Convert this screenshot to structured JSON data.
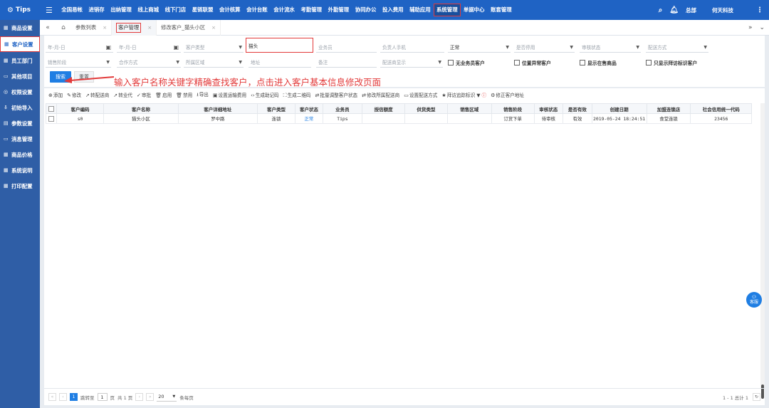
{
  "topbar": {
    "logo": "Tips",
    "menu": [
      "全国易帐",
      "进销存",
      "出纳管理",
      "线上商城",
      "线下门店",
      "星链联盟",
      "会计核算",
      "会计台账",
      "会计流水",
      "考勤管理",
      "外勤管理",
      "协同办公",
      "投入费用",
      "辅助应用",
      "系统管理",
      "单据中心",
      "账套管理"
    ],
    "active_menu": "系统管理",
    "user_role": "总部",
    "company": "何天科技"
  },
  "sidebar": {
    "items": [
      {
        "label": "商品设置"
      },
      {
        "label": "客户设置"
      },
      {
        "label": "员工部门"
      },
      {
        "label": "其他项目"
      },
      {
        "label": "权限设置"
      },
      {
        "label": "初始导入"
      },
      {
        "label": "参数设置"
      },
      {
        "label": "消息管理"
      },
      {
        "label": "商品价格"
      },
      {
        "label": "系统说明"
      },
      {
        "label": "打印配置"
      }
    ],
    "active_index": 1
  },
  "tabs": {
    "items": [
      {
        "label": "参数列表"
      },
      {
        "label": "客户管理"
      },
      {
        "label": "修改客户_猫头小区"
      }
    ],
    "active_index": 1
  },
  "filters": {
    "date_start_placeholder": "年-月-日",
    "date_end_placeholder": "年-月-日",
    "customer_type_placeholder": "客户类型",
    "keyword_value": "猫头",
    "salesman_placeholder": "业务员",
    "owner_phone_placeholder": "负责人手机",
    "status_value": "正常",
    "disabled_placeholder": "是否停用",
    "audit_placeholder": "审核状态",
    "delivery_placeholder": "配送方式",
    "sales_stage_placeholder": "销售阶段",
    "cooperation_placeholder": "合作方式",
    "region_placeholder": "所属区域",
    "address_placeholder": "地址",
    "remark_placeholder": "备注",
    "distributor_placeholder": "配送商显示",
    "cb_no_salesman": "无业务员客户",
    "cb_abnormal_position": "位置异常客户",
    "cb_show_on_sale": "显示在售商品",
    "cb_only_visit": "只显示拜访标识客户",
    "search_btn": "搜索",
    "reset_btn": "重置"
  },
  "annotation": "输入客户名称关键字精确查找客户，点击进入客户基本信息修改页面",
  "toolbar": [
    "添加",
    "修改",
    "转配送商",
    "转业代",
    "审批",
    "启用",
    "禁用",
    "导出",
    "设置运输费用",
    "生成助记码",
    "生成二维码",
    "批量调整客户状态",
    "修改所属配送商",
    "设置配送方式",
    "拜访追踪标识",
    "修正客户地址"
  ],
  "table": {
    "headers": [
      "客户编码",
      "客户名称",
      "客户详细地址",
      "客户类型",
      "客户状态",
      "业务员",
      "授信额度",
      "供货类型",
      "销售区域",
      "销售阶段",
      "审核状态",
      "是否有效",
      "创建日期",
      "加盟连锁店",
      "社会信用统一代码"
    ],
    "rows": [
      [
        "s0",
        "猫头小区",
        "罗中路",
        "连锁",
        "正常",
        "Tips",
        "",
        "",
        "",
        "订货下单",
        "待审核",
        "有效",
        "2019-05-24 18:24:51",
        "食堂连锁",
        "23456"
      ]
    ]
  },
  "pager": {
    "current_page": "1",
    "goto_label": "跳转至",
    "goto_value": "1",
    "page_unit": "页",
    "total_pages": "共 1 页",
    "page_size": "20",
    "per_page": "条每页",
    "summary": "1 - 1 总计 1"
  },
  "kefu": "客服"
}
